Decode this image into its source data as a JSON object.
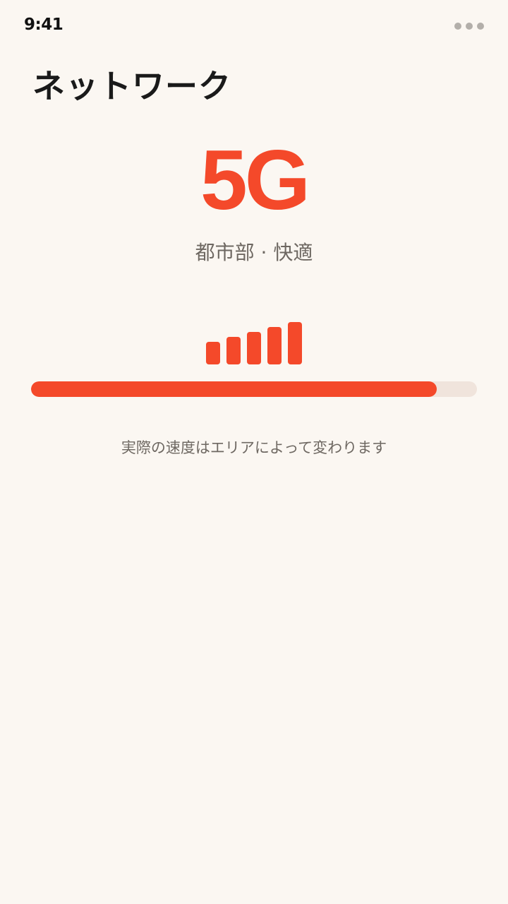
{
  "status_bar": {
    "time": "9:41",
    "more_icon": "ellipsis-icon"
  },
  "header": {
    "title": "ネットワーク"
  },
  "network": {
    "type": "5G",
    "subtitle": "都市部 · 快適",
    "signal_bars": {
      "active": 5,
      "total": 5,
      "icon": "signal-strength-icon"
    },
    "strength_fraction": 0.91
  },
  "footnote": "実際の速度はエリアによって変わります",
  "colors": {
    "accent": "#F4492A",
    "track": "#F0E4DC",
    "background": "#FBF7F2",
    "muted_text": "#6E6862",
    "dots": "#B3AFAA"
  }
}
